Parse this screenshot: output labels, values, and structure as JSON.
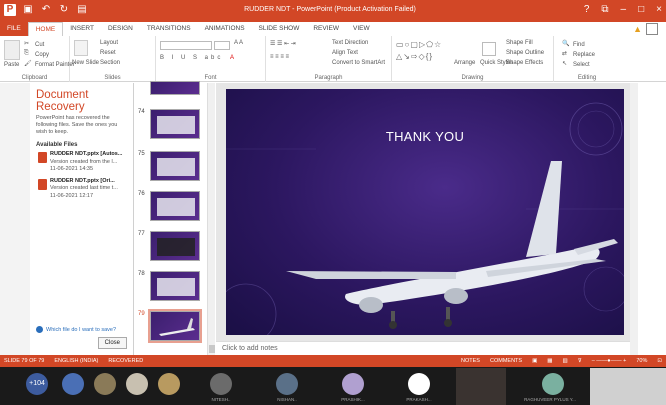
{
  "window": {
    "title": "RUDDER NDT - PowerPoint (Product Activation Failed)",
    "controls": [
      "?",
      "⧉",
      "–",
      "□",
      "×"
    ]
  },
  "ribbon": {
    "tabs": [
      "FILE",
      "HOME",
      "INSERT",
      "DESIGN",
      "TRANSITIONS",
      "ANIMATIONS",
      "SLIDE SHOW",
      "REVIEW",
      "VIEW"
    ],
    "active_tab": "HOME",
    "groups": {
      "clipboard": {
        "label": "Clipboard",
        "paste": "Paste",
        "cut": "Cut",
        "copy": "Copy",
        "format_painter": "Format Painter"
      },
      "slides": {
        "label": "Slides",
        "new_slide": "New Slide",
        "layout": "Layout",
        "reset": "Reset",
        "section": "Section"
      },
      "font": {
        "label": "Font"
      },
      "paragraph": {
        "label": "Paragraph",
        "text_direction": "Text Direction",
        "align_text": "Align Text",
        "convert_smartart": "Convert to SmartArt"
      },
      "drawing": {
        "label": "Drawing",
        "arrange": "Arrange",
        "quick_styles": "Quick Styles",
        "shape_fill": "Shape Fill",
        "shape_outline": "Shape Outline",
        "shape_effects": "Shape Effects"
      },
      "editing": {
        "label": "Editing",
        "find": "Find",
        "replace": "Replace",
        "select": "Select"
      }
    }
  },
  "recovery": {
    "title": "Document Recovery",
    "description": "PowerPoint has recovered the following files. Save the ones you wish to keep.",
    "available_label": "Available Files",
    "files": [
      {
        "name": "RUDDER NDT.pptx [Autos...",
        "status": "Version created from the l...",
        "date": "11-06-2021 14:35"
      },
      {
        "name": "RUDDER NDT.pptx [Ori...",
        "status": "Version created last time t...",
        "date": "11-06-2021 12:17"
      }
    ],
    "help_link": "Which file do I want to save?",
    "close_label": "Close"
  },
  "thumbnails": [
    {
      "num": "74"
    },
    {
      "num": "75"
    },
    {
      "num": "76"
    },
    {
      "num": "77"
    },
    {
      "num": "78"
    },
    {
      "num": "79"
    }
  ],
  "slide": {
    "title": "THANK YOU",
    "notes_placeholder": "Click to add notes"
  },
  "status": {
    "slide_info": "SLIDE 79 OF 79",
    "language": "ENGLISH (INDIA)",
    "state": "RECOVERED",
    "notes": "NOTES",
    "comments": "COMMENTS",
    "zoom": "70%"
  },
  "meeting": {
    "participant_count": "+104",
    "names": [
      "NITESH..",
      "NISHAN..",
      "PRASHIK...",
      "PRAKASH...",
      "RAGHUVEER PYLUS Y..."
    ]
  },
  "colors": {
    "accent": "#d24726",
    "slide_bg": "#2c1760"
  }
}
